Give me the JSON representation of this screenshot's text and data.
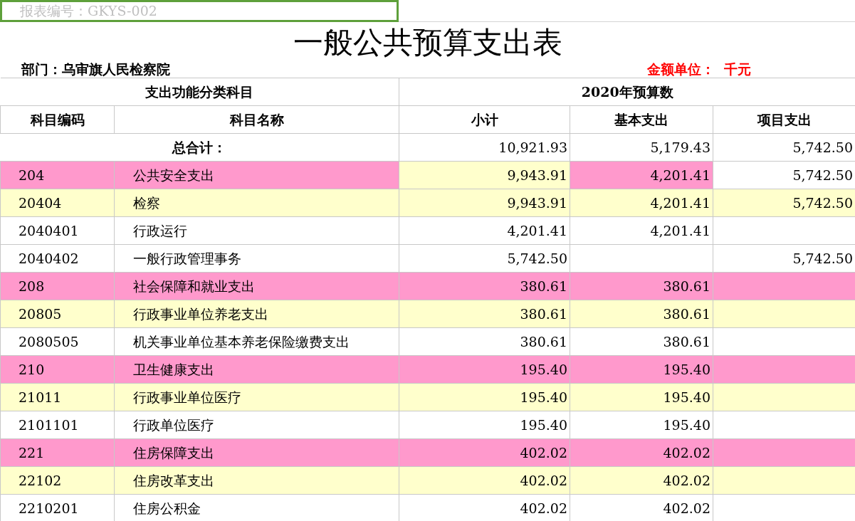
{
  "report_number": {
    "text": "报表编号：GKYS-002",
    "selected": true
  },
  "title": "一般公共预算支出表",
  "department": "部门：乌审旗人民检察院",
  "unit": "金额单位：  千元",
  "header": {
    "group_left": "支出功能分类科目",
    "group_right": "2020年预算数",
    "columns": [
      "科目编码",
      "科目名称",
      "小计",
      "基本支出",
      "项目支出"
    ]
  },
  "total": {
    "label": "总合计：",
    "values": [
      "10,921.93",
      "5,179.43",
      "5,742.50"
    ]
  },
  "rows": [
    {
      "cells": [
        {
          "text": "204",
          "color": "#ff99cc"
        },
        {
          "text": "公共安全支出",
          "color": "#ff99cc"
        },
        {
          "text": "9,943.91",
          "color": "#ffffcc"
        },
        {
          "text": "4,201.41",
          "color": "#ff99cc"
        },
        {
          "text": "5,742.50"
        }
      ]
    },
    {
      "cells": [
        {
          "text": "20404",
          "color": "#ffffcc"
        },
        {
          "text": "检察",
          "color": "#ffffcc"
        },
        {
          "text": "9,943.91",
          "color": "#ffffcc"
        },
        {
          "text": "4,201.41",
          "color": "#ffffcc"
        },
        {
          "text": "5,742.50",
          "color": "#ffffcc"
        }
      ]
    },
    {
      "cells": [
        {
          "text": "2040401"
        },
        {
          "text": "行政运行"
        },
        {
          "text": "4,201.41"
        },
        {
          "text": "4,201.41"
        },
        {
          "text": ""
        }
      ]
    },
    {
      "cells": [
        {
          "text": "2040402"
        },
        {
          "text": "一般行政管理事务"
        },
        {
          "text": "5,742.50"
        },
        {
          "text": ""
        },
        {
          "text": "5,742.50"
        }
      ]
    },
    {
      "cells": [
        {
          "text": "208",
          "color": "#ff99cc"
        },
        {
          "text": "社会保障和就业支出",
          "color": "#ff99cc"
        },
        {
          "text": "380.61",
          "color": "#ff99cc"
        },
        {
          "text": "380.61",
          "color": "#ff99cc"
        },
        {
          "text": "",
          "color": "#ff99cc"
        }
      ]
    },
    {
      "cells": [
        {
          "text": "20805",
          "color": "#ffffcc"
        },
        {
          "text": "行政事业单位养老支出",
          "color": "#ffffcc"
        },
        {
          "text": "380.61",
          "color": "#ffffcc"
        },
        {
          "text": "380.61",
          "color": "#ffffcc"
        },
        {
          "text": "",
          "color": "#ffffcc"
        }
      ]
    },
    {
      "cells": [
        {
          "text": "2080505"
        },
        {
          "text": "机关事业单位基本养老保险缴费支出"
        },
        {
          "text": "380.61"
        },
        {
          "text": "380.61"
        },
        {
          "text": ""
        }
      ]
    },
    {
      "cells": [
        {
          "text": "210",
          "color": "#ff99cc"
        },
        {
          "text": "卫生健康支出",
          "color": "#ff99cc"
        },
        {
          "text": "195.40",
          "color": "#ff99cc"
        },
        {
          "text": "195.40",
          "color": "#ff99cc"
        },
        {
          "text": "",
          "color": "#ff99cc"
        }
      ]
    },
    {
      "cells": [
        {
          "text": "21011",
          "color": "#ffffcc"
        },
        {
          "text": "行政事业单位医疗",
          "color": "#ffffcc"
        },
        {
          "text": "195.40",
          "color": "#ffffcc"
        },
        {
          "text": "195.40",
          "color": "#ffffcc"
        },
        {
          "text": "",
          "color": "#ffffcc"
        }
      ]
    },
    {
      "cells": [
        {
          "text": "2101101"
        },
        {
          "text": "行政单位医疗"
        },
        {
          "text": "195.40"
        },
        {
          "text": "195.40"
        },
        {
          "text": ""
        }
      ]
    },
    {
      "cells": [
        {
          "text": "221",
          "color": "#ff99cc"
        },
        {
          "text": "住房保障支出",
          "color": "#ff99cc"
        },
        {
          "text": "402.02",
          "color": "#ff99cc"
        },
        {
          "text": "402.02",
          "color": "#ff99cc"
        },
        {
          "text": "",
          "color": "#ff99cc"
        }
      ]
    },
    {
      "cells": [
        {
          "text": "22102",
          "color": "#ffffcc"
        },
        {
          "text": "住房改革支出",
          "color": "#ffffcc"
        },
        {
          "text": "402.02",
          "color": "#ffffcc"
        },
        {
          "text": "402.02",
          "color": "#ffffcc"
        },
        {
          "text": "",
          "color": "#ffffcc"
        }
      ]
    },
    {
      "cells": [
        {
          "text": "2210201"
        },
        {
          "text": "住房公积金"
        },
        {
          "text": "402.02"
        },
        {
          "text": "402.02"
        },
        {
          "text": ""
        }
      ]
    }
  ]
}
